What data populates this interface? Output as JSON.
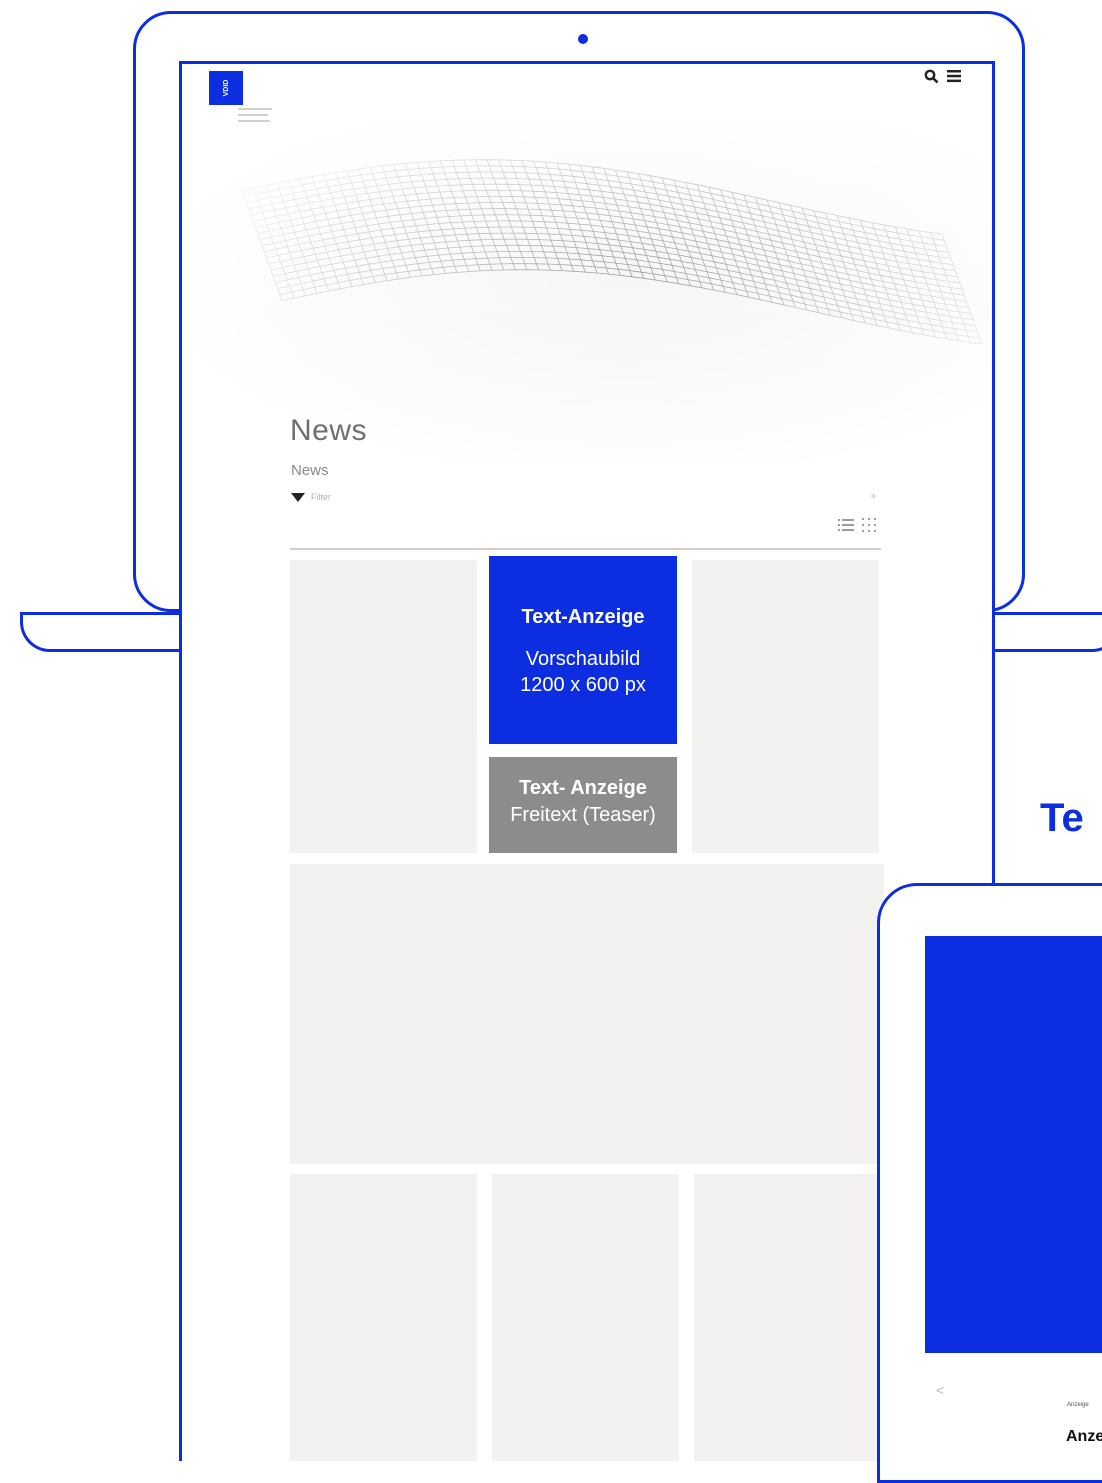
{
  "header": {
    "logo_text": "VDID",
    "search_icon": "search-icon",
    "menu_icon": "hamburger-menu-icon"
  },
  "page": {
    "title": "News",
    "breadcrumb": "News",
    "filter_label": "Filter",
    "plus_label": "+"
  },
  "ads": {
    "blue": {
      "title": "Text-Anzeige",
      "line1": "Vorschaubild",
      "line2": "1200 x 600 px"
    },
    "grey": {
      "title": "Text- Anzeige",
      "subtitle": "Freitext (Teaser)"
    }
  },
  "side": {
    "label": "Te",
    "tablet_small": "Anzeige",
    "tablet_big": "Anze"
  },
  "colors": {
    "accent": "#0c2ee0",
    "placeholder_card": "#f4f2f0",
    "grey_ad": "#8c8c8c"
  }
}
